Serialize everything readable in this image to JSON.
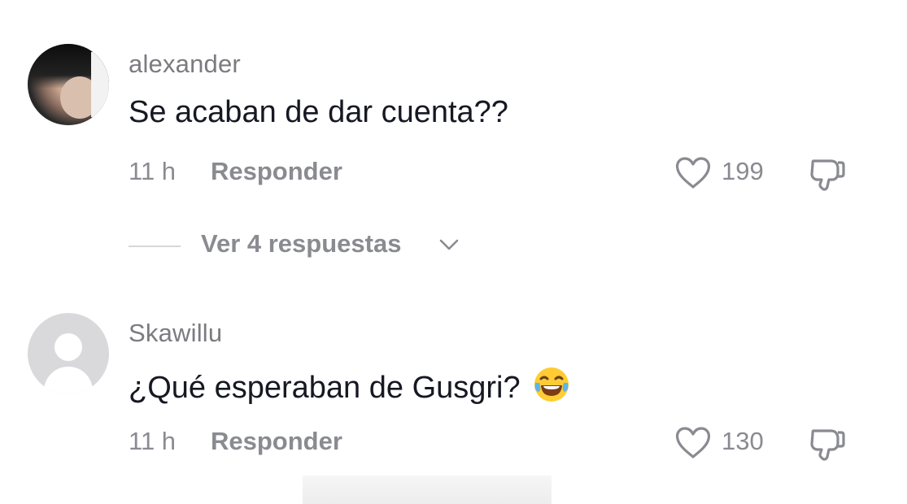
{
  "comments": [
    {
      "username": "alexander",
      "text": "Se acaban de dar cuenta??",
      "time": "11 h",
      "reply_label": "Responder",
      "likes": "199",
      "avatar": "user-photo",
      "view_replies": "Ver 4 respuestas"
    },
    {
      "username": "Skawillu",
      "text": "¿Qué esperaban de Gusgri?",
      "emoji": "face-with-tears-of-joy",
      "time": "11 h",
      "reply_label": "Responder",
      "likes": "130",
      "avatar": "default-avatar"
    }
  ],
  "icons": {
    "like": "heart-outline-icon",
    "dislike": "thumbs-down-icon",
    "expand": "chevron-down-icon"
  },
  "colors": {
    "username": "#7b7b80",
    "text": "#161823",
    "meta": "#8a8b91"
  }
}
